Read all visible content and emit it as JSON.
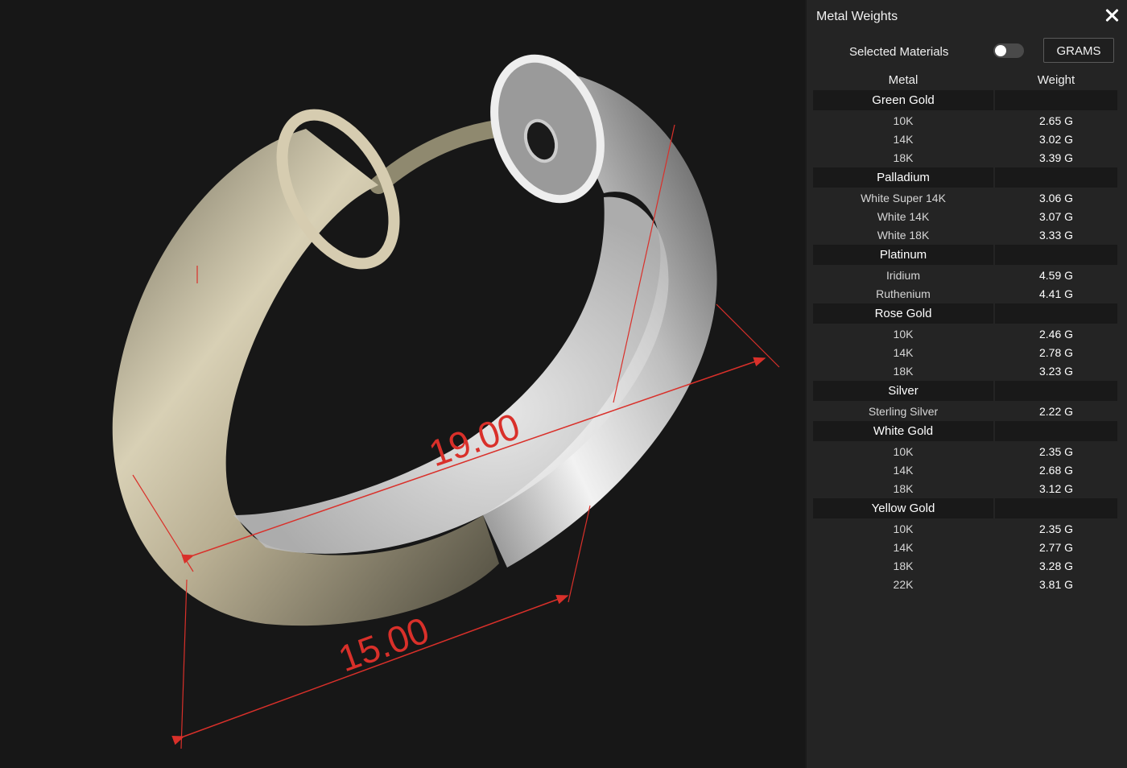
{
  "viewport": {
    "dimensions": {
      "diameter": "19.00",
      "width": "15.00"
    },
    "colors": {
      "dimension_line": "#d9302a",
      "gold_metal": "#b8ae92",
      "white_metal": "#d8d8d8"
    }
  },
  "panel": {
    "title": "Metal Weights",
    "close_icon": "close-icon",
    "selected_materials_label": "Selected Materials",
    "toggle_on": false,
    "unit_button_label": "GRAMS",
    "table": {
      "headers": {
        "metal": "Metal",
        "weight": "Weight"
      },
      "categories": [
        {
          "name": "Green Gold",
          "items": [
            {
              "metal": "10K",
              "weight": "2.65 G"
            },
            {
              "metal": "14K",
              "weight": "3.02 G"
            },
            {
              "metal": "18K",
              "weight": "3.39 G"
            }
          ]
        },
        {
          "name": "Palladium",
          "items": [
            {
              "metal": "White Super 14K",
              "weight": "3.06 G"
            },
            {
              "metal": "White 14K",
              "weight": "3.07 G"
            },
            {
              "metal": "White 18K",
              "weight": "3.33 G"
            }
          ]
        },
        {
          "name": "Platinum",
          "items": [
            {
              "metal": "Iridium",
              "weight": "4.59 G"
            },
            {
              "metal": "Ruthenium",
              "weight": "4.41 G"
            }
          ]
        },
        {
          "name": "Rose Gold",
          "items": [
            {
              "metal": "10K",
              "weight": "2.46 G"
            },
            {
              "metal": "14K",
              "weight": "2.78 G"
            },
            {
              "metal": "18K",
              "weight": "3.23 G"
            }
          ]
        },
        {
          "name": "Silver",
          "items": [
            {
              "metal": "Sterling Silver",
              "weight": "2.22 G"
            }
          ]
        },
        {
          "name": "White Gold",
          "items": [
            {
              "metal": "10K",
              "weight": "2.35 G"
            },
            {
              "metal": "14K",
              "weight": "2.68 G"
            },
            {
              "metal": "18K",
              "weight": "3.12 G"
            }
          ]
        },
        {
          "name": "Yellow Gold",
          "items": [
            {
              "metal": "10K",
              "weight": "2.35 G"
            },
            {
              "metal": "14K",
              "weight": "2.77 G"
            },
            {
              "metal": "18K",
              "weight": "3.28 G"
            },
            {
              "metal": "22K",
              "weight": "3.81 G"
            }
          ]
        }
      ]
    }
  }
}
